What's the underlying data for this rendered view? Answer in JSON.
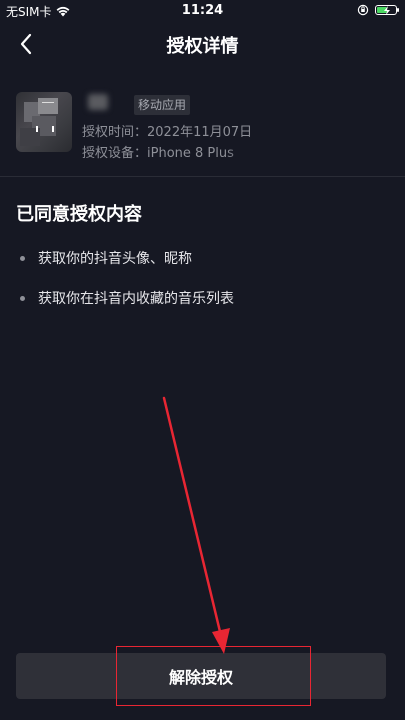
{
  "status_bar": {
    "carrier": "无SIM卡",
    "time": "11:24"
  },
  "nav": {
    "title": "授权详情"
  },
  "app": {
    "tag": "移动应用",
    "auth_time_label": "授权时间：",
    "auth_time_value": "2022年11月07日",
    "auth_device_label": "授权设备：",
    "auth_device_value": "iPhone 8 Plus"
  },
  "permissions": {
    "title": "已同意授权内容",
    "items": [
      "获取你的抖音头像、昵称",
      "获取你在抖音内收藏的音乐列表"
    ]
  },
  "actions": {
    "revoke_label": "解除授权"
  },
  "colors": {
    "background": "#161823",
    "annotation": "#e82633",
    "button": "#2f3038"
  }
}
